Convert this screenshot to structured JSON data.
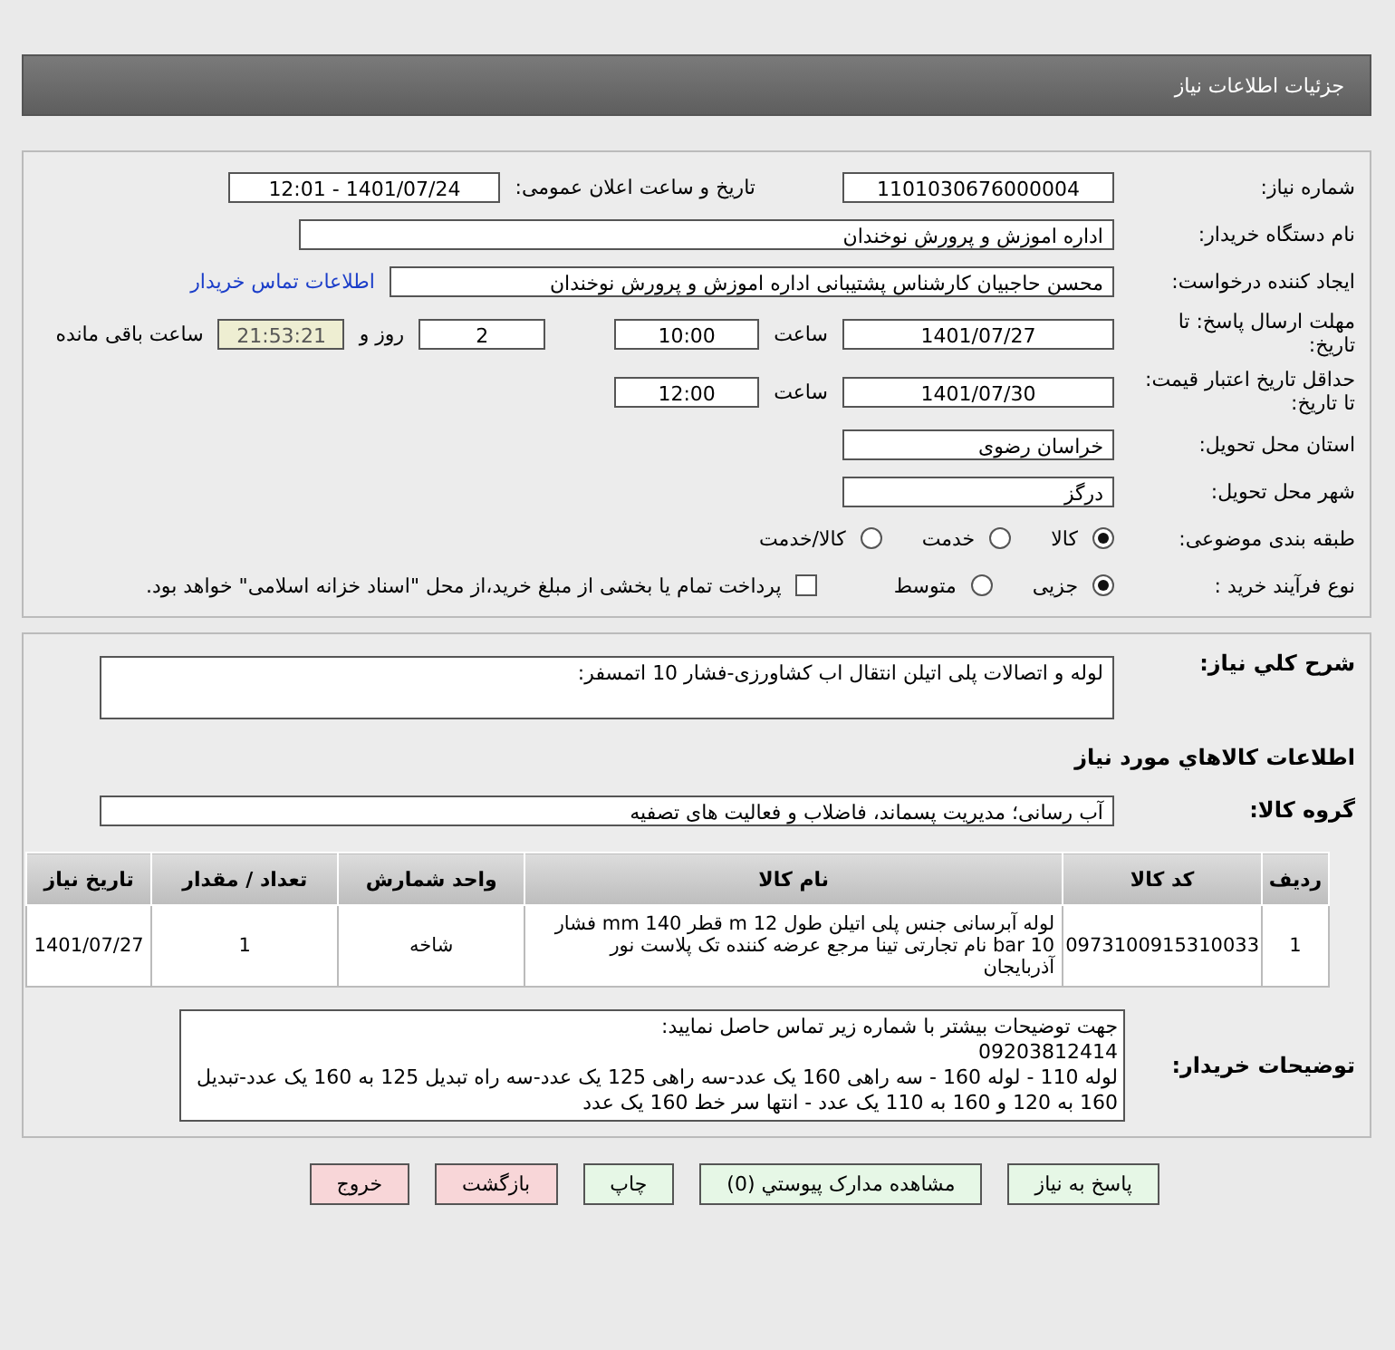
{
  "header": {
    "title": "جزئیات اطلاعات نیاز"
  },
  "need_number": {
    "label": "شماره نیاز:",
    "value": "1101030676000004"
  },
  "announce": {
    "label": "تاریخ و ساعت اعلان عمومی:",
    "value": "1401/07/24 - 12:01"
  },
  "buyer_org": {
    "label": "نام دستگاه خریدار:",
    "value": "اداره اموزش و پرورش نوخندان"
  },
  "requester": {
    "label": "ایجاد کننده درخواست:",
    "value": "محسن حاجبیان کارشناس پشتیبانی اداره اموزش و پرورش نوخندان",
    "link": "اطلاعات تماس خریدار"
  },
  "deadline": {
    "label": "مهلت ارسال پاسخ: تا تاریخ:",
    "date": "1401/07/27",
    "time_label": "ساعت",
    "time": "10:00",
    "days": "2",
    "days_label": "روز و",
    "remaining": "21:53:21",
    "remaining_label": "ساعت باقی مانده"
  },
  "validity": {
    "label": "حداقل تاریخ اعتبار قیمت: تا تاریخ:",
    "date": "1401/07/30",
    "time_label": "ساعت",
    "time": "12:00"
  },
  "province": {
    "label": "استان محل تحویل:",
    "value": "خراسان رضوی"
  },
  "city": {
    "label": "شهر محل تحویل:",
    "value": "درگز"
  },
  "category": {
    "label": "طبقه بندی موضوعی:",
    "options": [
      {
        "label": "کالا",
        "selected": true
      },
      {
        "label": "خدمت",
        "selected": false
      },
      {
        "label": "کالا/خدمت",
        "selected": false
      }
    ]
  },
  "process": {
    "label": "نوع فرآیند خرید :",
    "options": [
      {
        "label": "جزیی",
        "selected": true
      },
      {
        "label": "متوسط",
        "selected": false
      }
    ],
    "payment": {
      "label": "پرداخت تمام یا بخشی از مبلغ خرید،از محل \"اسناد خزانه اسلامی\" خواهد بود.",
      "checked": false
    }
  },
  "summary": {
    "label": "شرح کلي نیاز:",
    "value": "لوله و اتصالات پلی اتیلن انتقال اب کشاورزی-فشار 10 اتمسفر:"
  },
  "goods_title": "اطلاعات کالاهاي مورد نیاز",
  "goods_group": {
    "label": "گروه کالا:",
    "value": "آب رسانی؛ مدیریت پسماند، فاضلاب و فعالیت های تصفیه"
  },
  "table": {
    "columns": [
      "ردیف",
      "کد کالا",
      "نام کالا",
      "واحد شمارش",
      "تعداد / مقدار",
      "تاریخ نیاز"
    ],
    "rows": [
      [
        "1",
        "0973100915310033",
        "لوله آبرسانی جنس پلی اتیلن طول m 12 قطر mm 140 فشار bar 10 نام تجارتی تینا مرجع عرضه کننده تک پلاست نور آذربایجان",
        "شاخه",
        "1",
        "1401/07/27"
      ]
    ]
  },
  "notes": {
    "label": "توضیحات خریدار:",
    "lines": [
      "جهت توضیحات بیشتر با شماره زیر تماس حاصل نمایید:",
      "09203812414",
      "لوله 110 - لوله 160 - سه  راهی 160 یک عدد-سه راهی 125 یک عدد-سه راه تبدیل 125 به 160 یک عدد-تبدیل 160 به 120 و 160 به 110 یک عدد - انتها سر خط 160 یک عدد"
    ]
  },
  "buttons": [
    {
      "label": "پاسخ به نیاز",
      "kind": "primary"
    },
    {
      "label": "مشاهده مدارک پیوستي (0)",
      "kind": "primary"
    },
    {
      "label": "چاپ",
      "kind": "primary"
    },
    {
      "label": "بازگشت",
      "kind": "danger"
    },
    {
      "label": "خروج",
      "kind": "danger"
    }
  ]
}
